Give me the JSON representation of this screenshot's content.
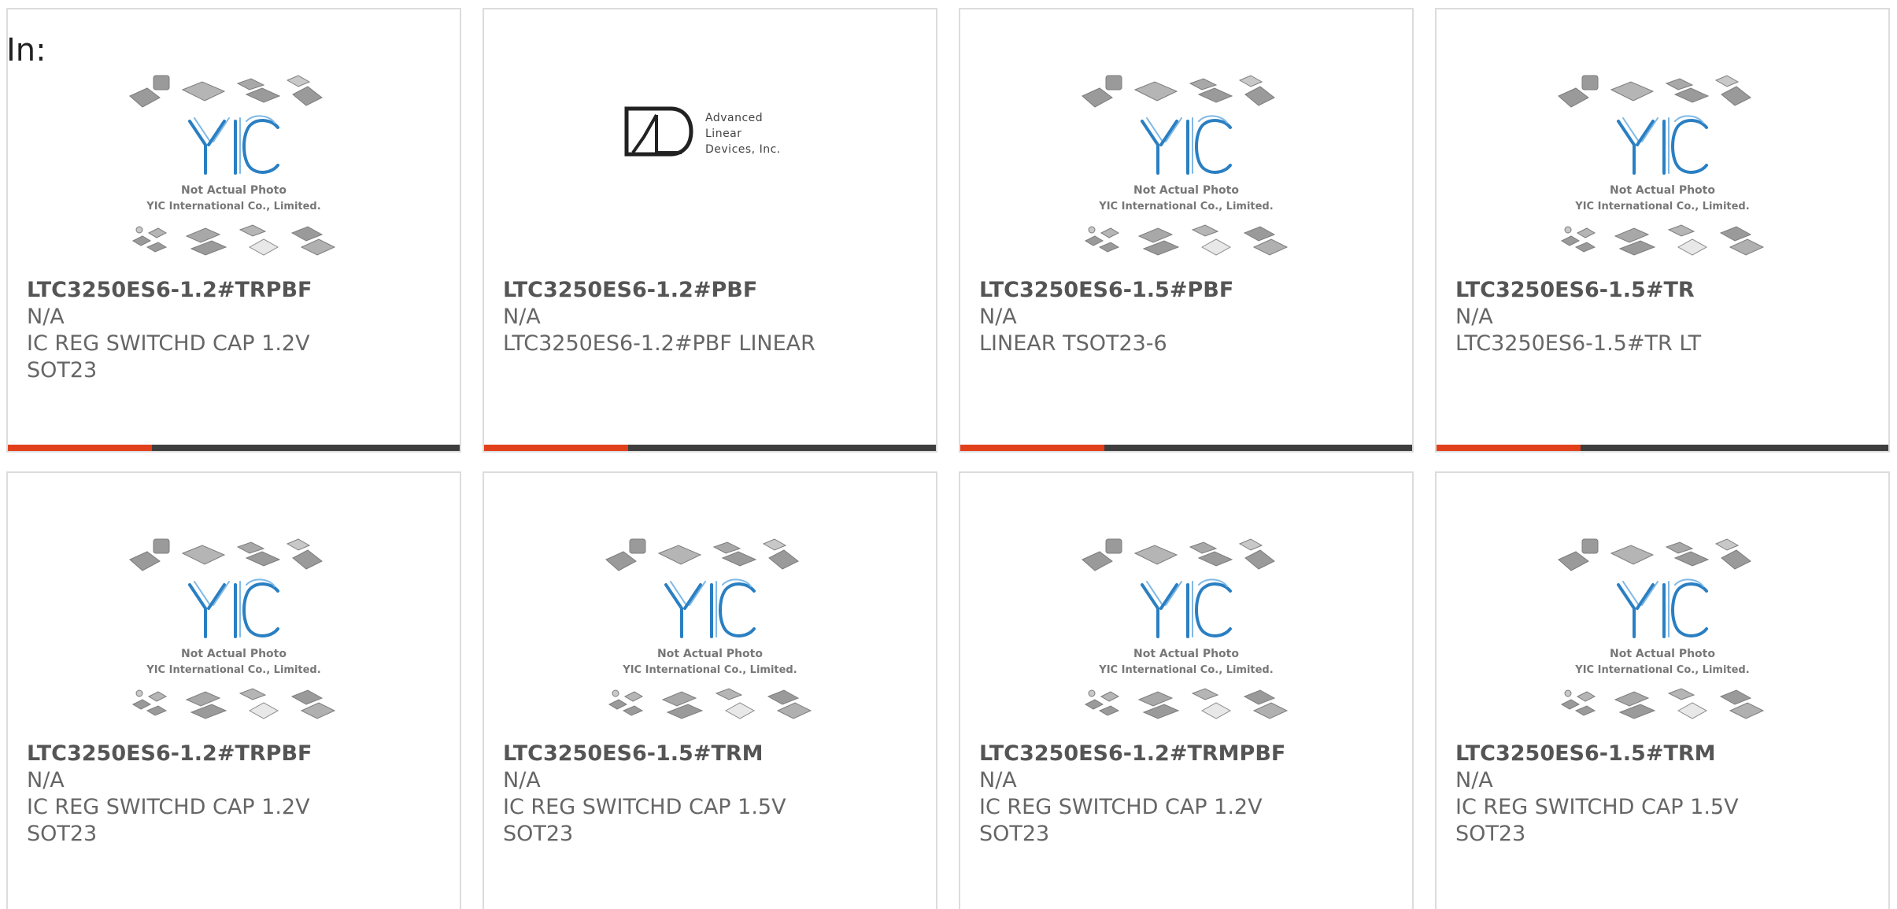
{
  "header": {
    "in_label": "In:"
  },
  "placeholder_image": {
    "caption_line1": "Not Actual Photo",
    "caption_line2": "YIC International Co., Limited.",
    "logo_text": "YIC"
  },
  "adi_logo": {
    "line1": "Advanced",
    "line2": "Linear",
    "line3": "Devices, Inc."
  },
  "colors": {
    "accent": "#e2401b",
    "bar_dark": "#3e3e3e",
    "border": "#dcdcdc",
    "logo_blue": "#2a7fc2"
  },
  "products": [
    {
      "name": "LTC3250ES6-1.2#TRPBF",
      "status": "N/A",
      "desc1": "IC REG SWITCHD CAP 1.2V",
      "desc2": "SOT23",
      "image": "yic-placeholder"
    },
    {
      "name": "LTC3250ES6-1.2#PBF",
      "status": "N/A",
      "desc1": "LTC3250ES6-1.2#PBF LINEAR",
      "desc2": "",
      "image": "adi-logo"
    },
    {
      "name": "LTC3250ES6-1.5#PBF",
      "status": "N/A",
      "desc1": "LINEAR TSOT23-6",
      "desc2": "",
      "image": "yic-placeholder"
    },
    {
      "name": "LTC3250ES6-1.5#TR",
      "status": "N/A",
      "desc1": "LTC3250ES6-1.5#TR LT",
      "desc2": "",
      "image": "yic-placeholder"
    },
    {
      "name": "LTC3250ES6-1.2#TRPBF",
      "status": "N/A",
      "desc1": "IC REG SWITCHD CAP 1.2V",
      "desc2": "SOT23",
      "image": "yic-placeholder"
    },
    {
      "name": "LTC3250ES6-1.5#TRM",
      "status": "N/A",
      "desc1": "IC REG SWITCHD CAP 1.5V",
      "desc2": "SOT23",
      "image": "yic-placeholder"
    },
    {
      "name": "LTC3250ES6-1.2#TRMPBF",
      "status": "N/A",
      "desc1": "IC REG SWITCHD CAP 1.2V",
      "desc2": "SOT23",
      "image": "yic-placeholder"
    },
    {
      "name": "LTC3250ES6-1.5#TRM",
      "status": "N/A",
      "desc1": "IC REG SWITCHD CAP 1.5V",
      "desc2": "SOT23",
      "image": "yic-placeholder"
    }
  ]
}
